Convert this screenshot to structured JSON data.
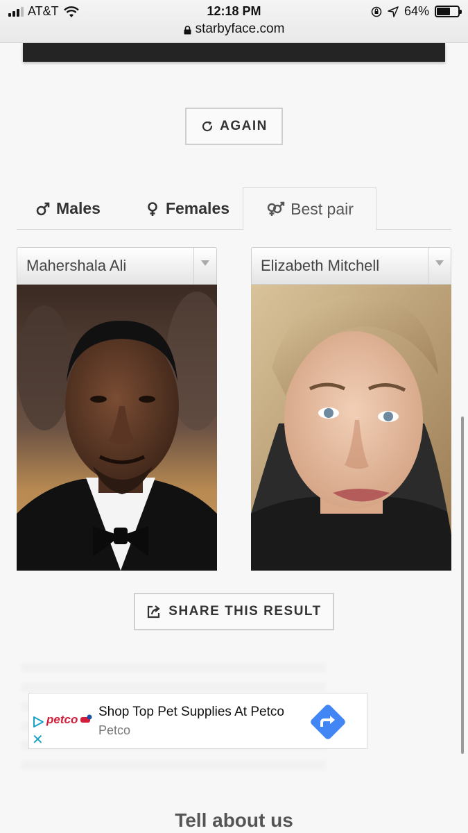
{
  "status_bar": {
    "carrier": "AT&T",
    "time": "12:18 PM",
    "battery": "64%",
    "battery_level": 0.64,
    "url": "starbyface.com"
  },
  "actions": {
    "again_label": "AGAIN",
    "share_label": "SHARE THIS RESULT"
  },
  "tabs": [
    {
      "label": "Males",
      "icon": "male-icon",
      "active": false
    },
    {
      "label": "Females",
      "icon": "female-icon",
      "active": false
    },
    {
      "label": "Best pair",
      "icon": "pair-icon",
      "active": true
    }
  ],
  "results": {
    "left": {
      "name": "Mahershala Ali"
    },
    "right": {
      "name": "Elizabeth Mitchell"
    }
  },
  "ad": {
    "logo_text": "petco",
    "title": "Shop Top Pet Supplies At Petco",
    "advertiser": "Petco",
    "close_symbol": "✕"
  },
  "footer": {
    "title": "Tell about us"
  },
  "colors": {
    "background": "#f7f7f7",
    "accent_blue": "#4285f4",
    "petco_red": "#d11e3a"
  }
}
